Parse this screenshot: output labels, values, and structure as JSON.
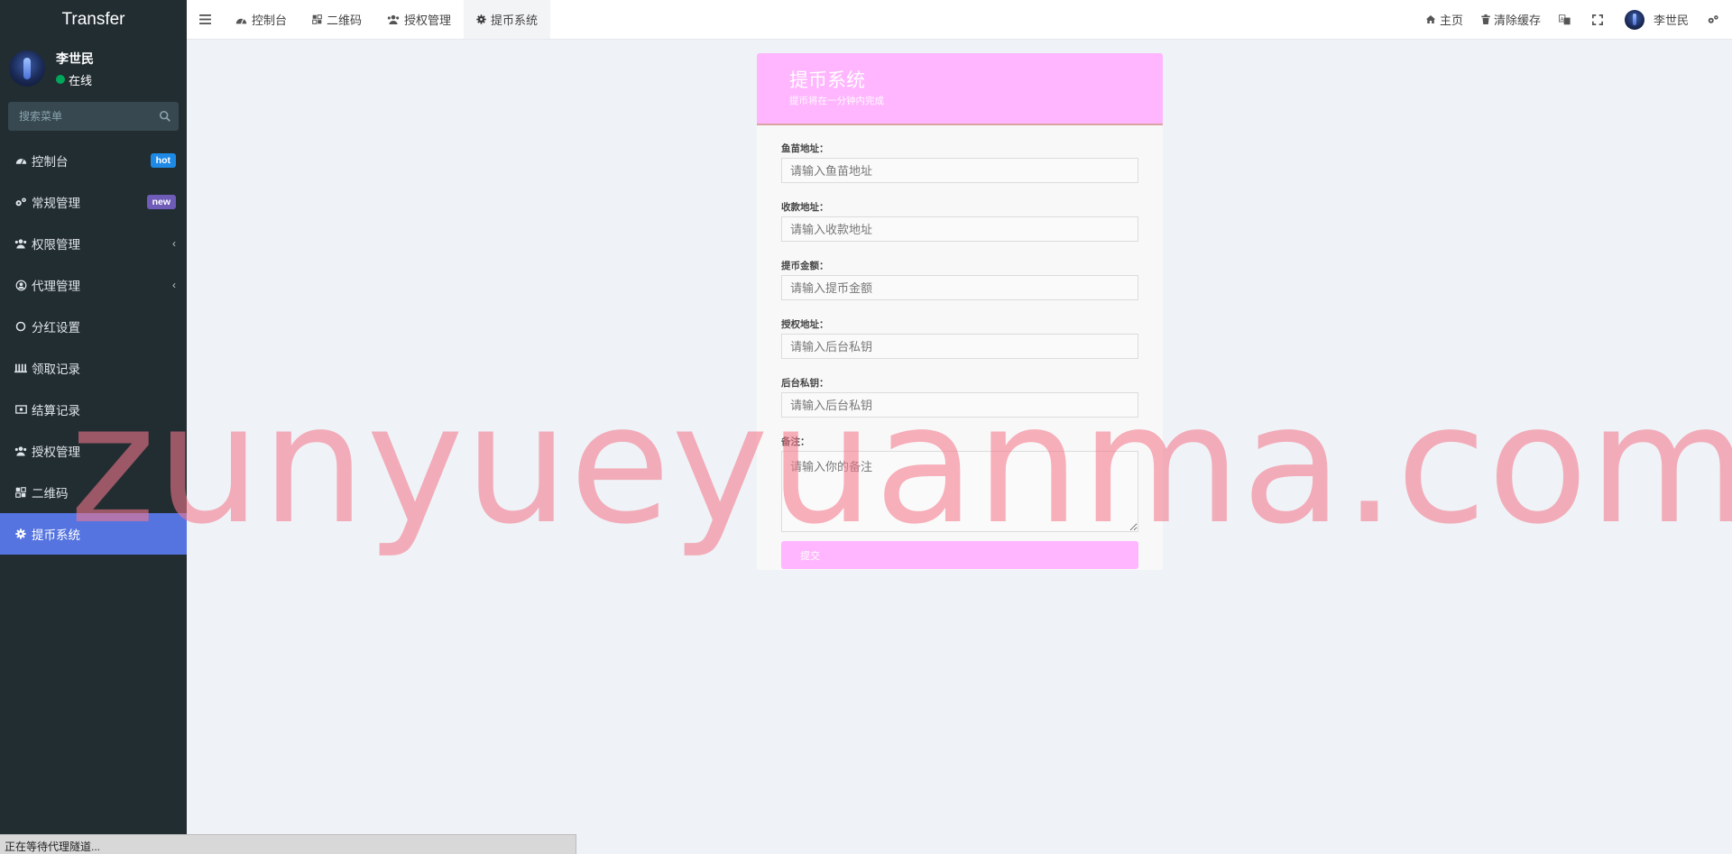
{
  "sidebar": {
    "brand": "Transfer",
    "user": {
      "name": "李世民",
      "status": "在线"
    },
    "search": {
      "placeholder": "搜索菜单"
    },
    "items": [
      {
        "label": "控制台",
        "icon": "dashboard-icon",
        "badge": "hot"
      },
      {
        "label": "常规管理",
        "icon": "cogs-icon",
        "badge": "new"
      },
      {
        "label": "权限管理",
        "icon": "users-icon",
        "chevron": true
      },
      {
        "label": "代理管理",
        "icon": "user-circle-icon",
        "chevron": true
      },
      {
        "label": "分红设置",
        "icon": "circle-icon"
      },
      {
        "label": "领取记录",
        "icon": "list-icon"
      },
      {
        "label": "结算记录",
        "icon": "money-icon"
      },
      {
        "label": "授权管理",
        "icon": "users-icon"
      },
      {
        "label": "二维码",
        "icon": "qrcode-icon"
      },
      {
        "label": "提币系统",
        "icon": "gear-icon",
        "active": true
      }
    ]
  },
  "topnav": {
    "tabs": [
      {
        "label": "控制台",
        "icon": "dashboard-icon"
      },
      {
        "label": "二维码",
        "icon": "qrcode-icon"
      },
      {
        "label": "授权管理",
        "icon": "users-icon"
      },
      {
        "label": "提币系统",
        "icon": "gear-icon",
        "active": true
      }
    ],
    "right": {
      "home": "主页",
      "clear_cache": "清除缓存",
      "user": "李世民"
    }
  },
  "form": {
    "title": "提币系统",
    "subtitle": "提币将在一分钟内完成",
    "fields": [
      {
        "label": "鱼苗地址：",
        "placeholder": "请输入鱼苗地址"
      },
      {
        "label": "收款地址：",
        "placeholder": "请输入收款地址"
      },
      {
        "label": "提币金额：",
        "placeholder": "请输入提币金额"
      },
      {
        "label": "授权地址：",
        "placeholder": "请输入后台私钥"
      },
      {
        "label": "后台私钥：",
        "placeholder": "请输入后台私钥"
      }
    ],
    "remark": {
      "label": "备注：",
      "placeholder": "请输入你的备注"
    },
    "submit": "提交"
  },
  "watermark": "zunyueyuanma.com",
  "statusbar": "正在等待代理隧道...",
  "colors": {
    "sidebar_bg": "#222d32",
    "active_item": "#5574e0",
    "form_header": "#ffb6ff",
    "badge_hot": "#1e8ae6",
    "badge_new": "#6f5bb8",
    "online_dot": "#00a65a"
  }
}
